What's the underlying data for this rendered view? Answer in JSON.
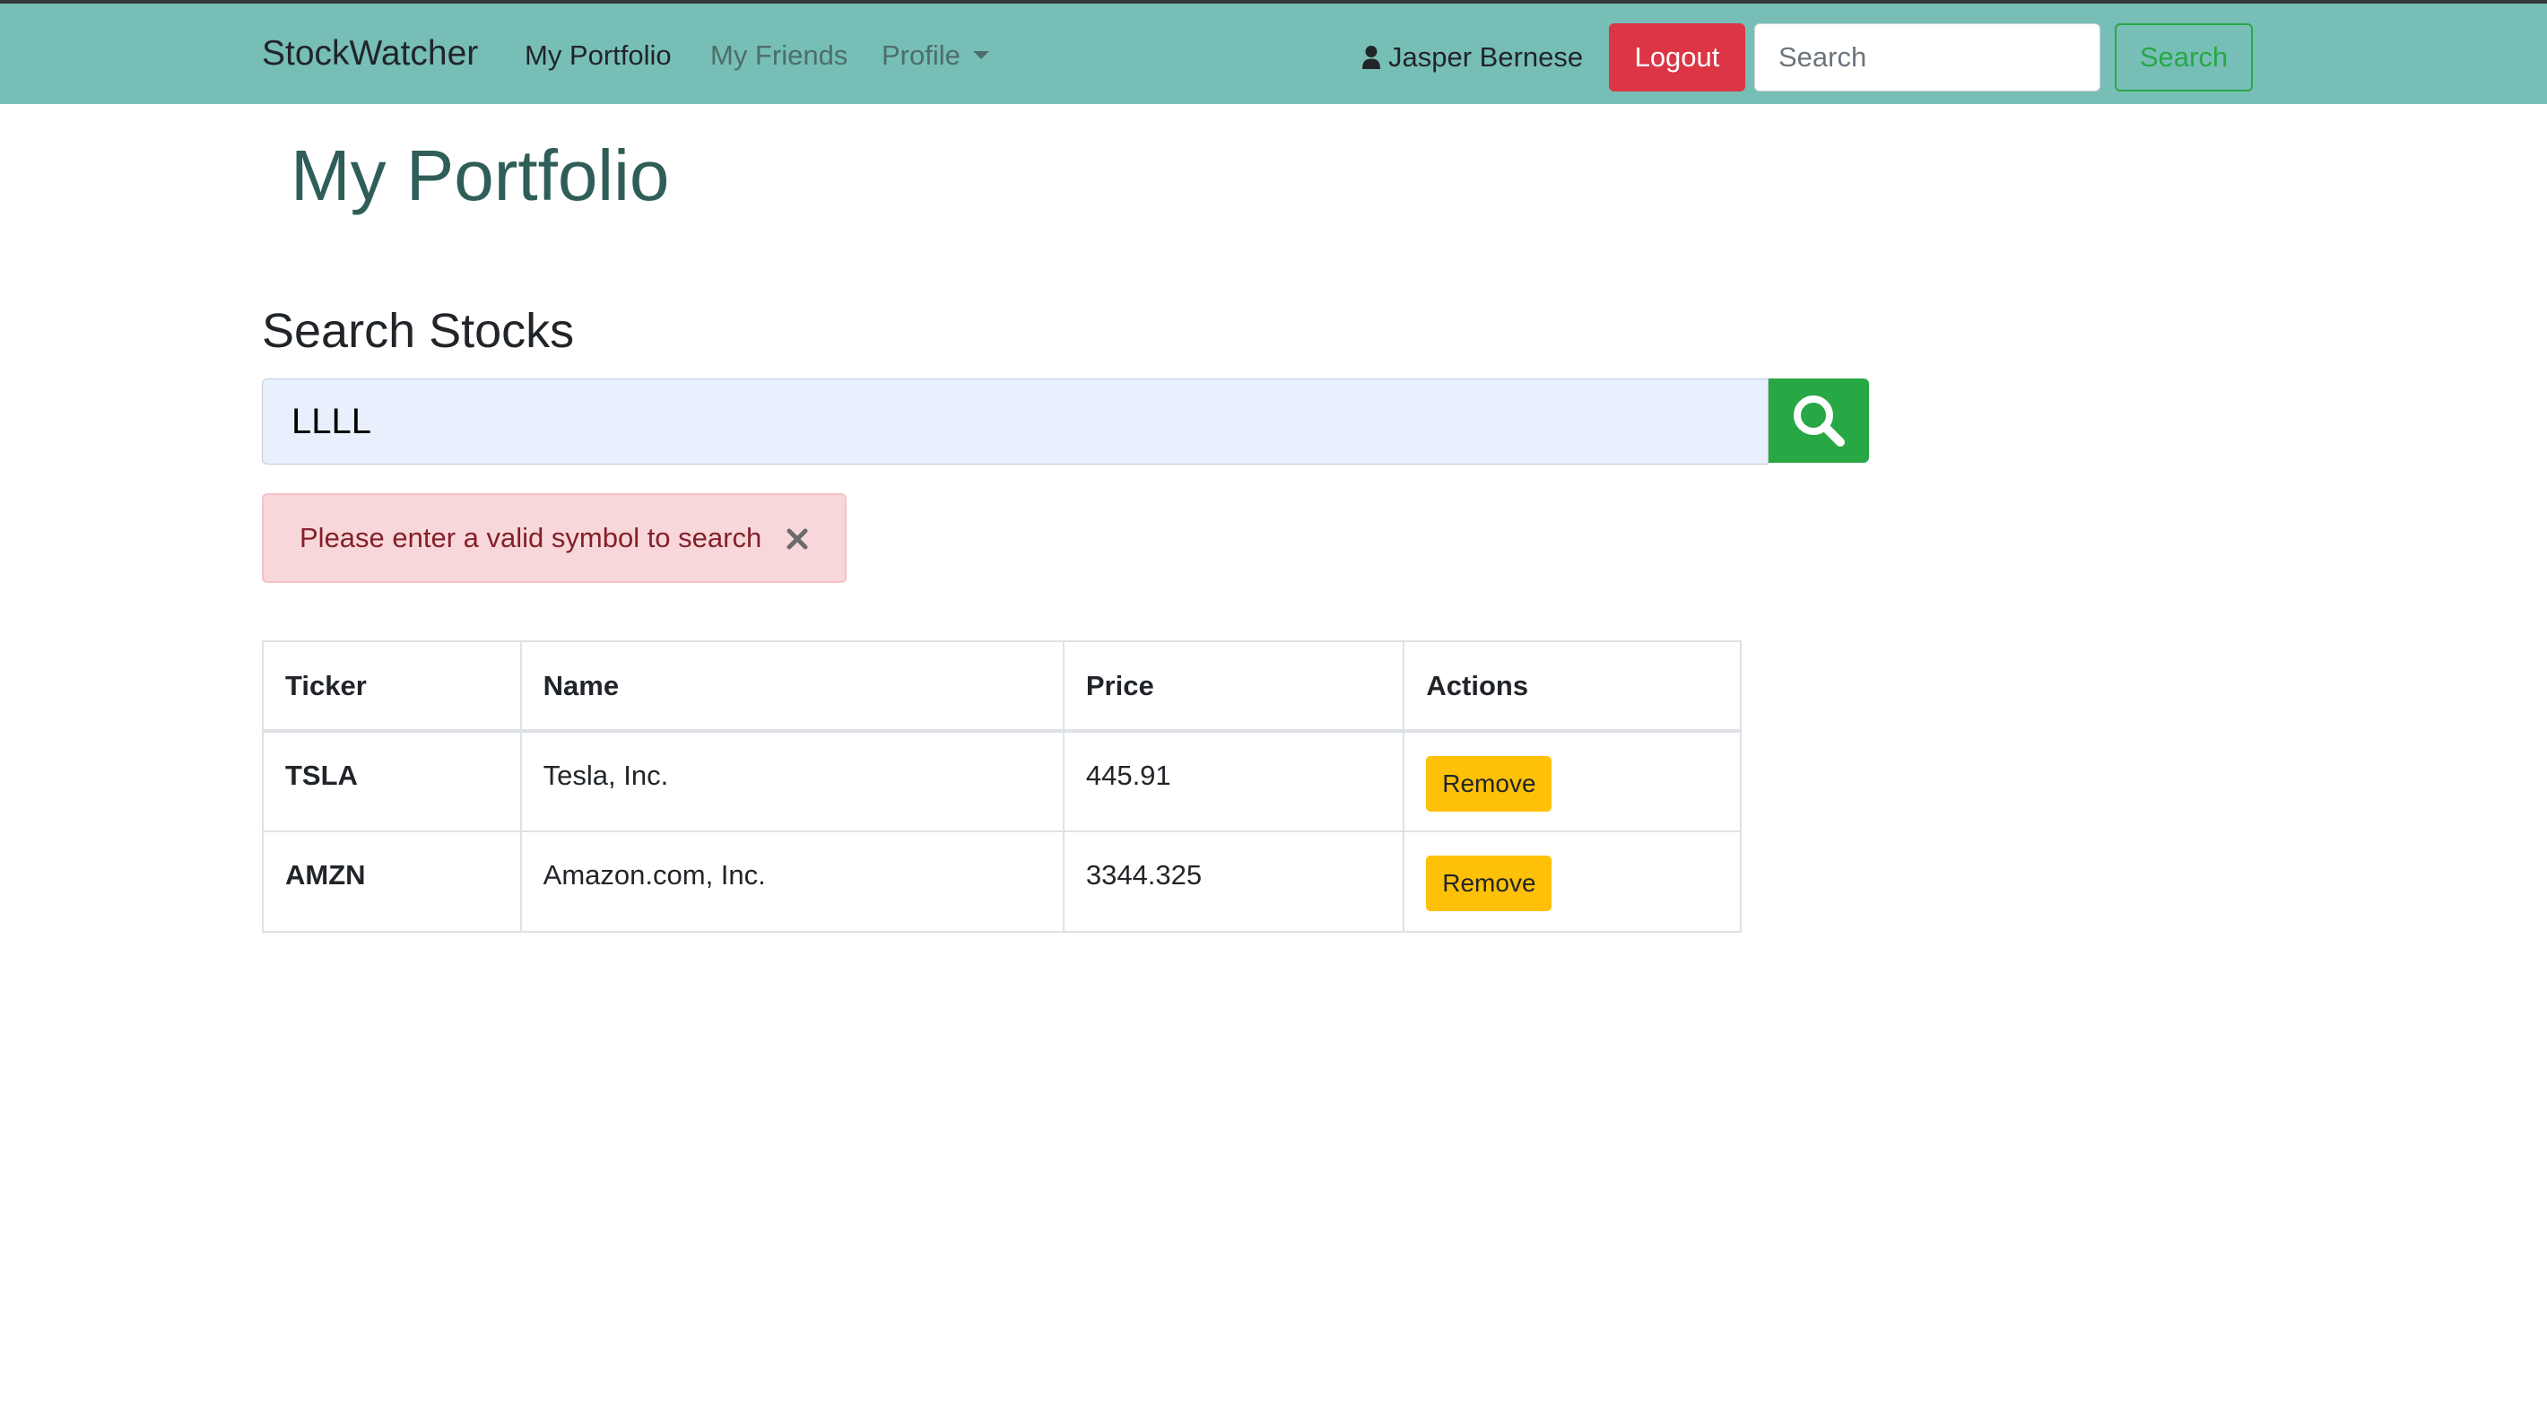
{
  "navbar": {
    "brand": "StockWatcher",
    "links": [
      {
        "label": "My Portfolio",
        "active": true
      },
      {
        "label": "My Friends",
        "active": false
      },
      {
        "label": "Profile",
        "active": false
      }
    ],
    "user_name": "Jasper Bernese",
    "user_icon": "user-icon",
    "logout_label": "Logout",
    "search_placeholder": "Search",
    "search_button_label": "Search"
  },
  "page": {
    "title": "My Portfolio",
    "search_section_title": "Search Stocks",
    "stock_search_value": "LLLL",
    "search_icon": "search-icon"
  },
  "alert": {
    "message": "Please enter a valid symbol to search",
    "close_icon": "close-icon"
  },
  "table": {
    "headers": [
      "Ticker",
      "Name",
      "Price",
      "Actions"
    ],
    "rows": [
      {
        "ticker": "TSLA",
        "name": "Tesla, Inc.",
        "price": "445.91",
        "action": "Remove"
      },
      {
        "ticker": "AMZN",
        "name": "Amazon.com, Inc.",
        "price": "3344.325",
        "action": "Remove"
      }
    ]
  },
  "colors": {
    "navbar_bg": "#77bfb6",
    "title_color": "#2f5e58",
    "logout_bg": "#dc3545",
    "success": "#28a745",
    "warning": "#ffc107",
    "alert_bg": "#f8d7da",
    "input_bg": "#e8f0fe"
  }
}
